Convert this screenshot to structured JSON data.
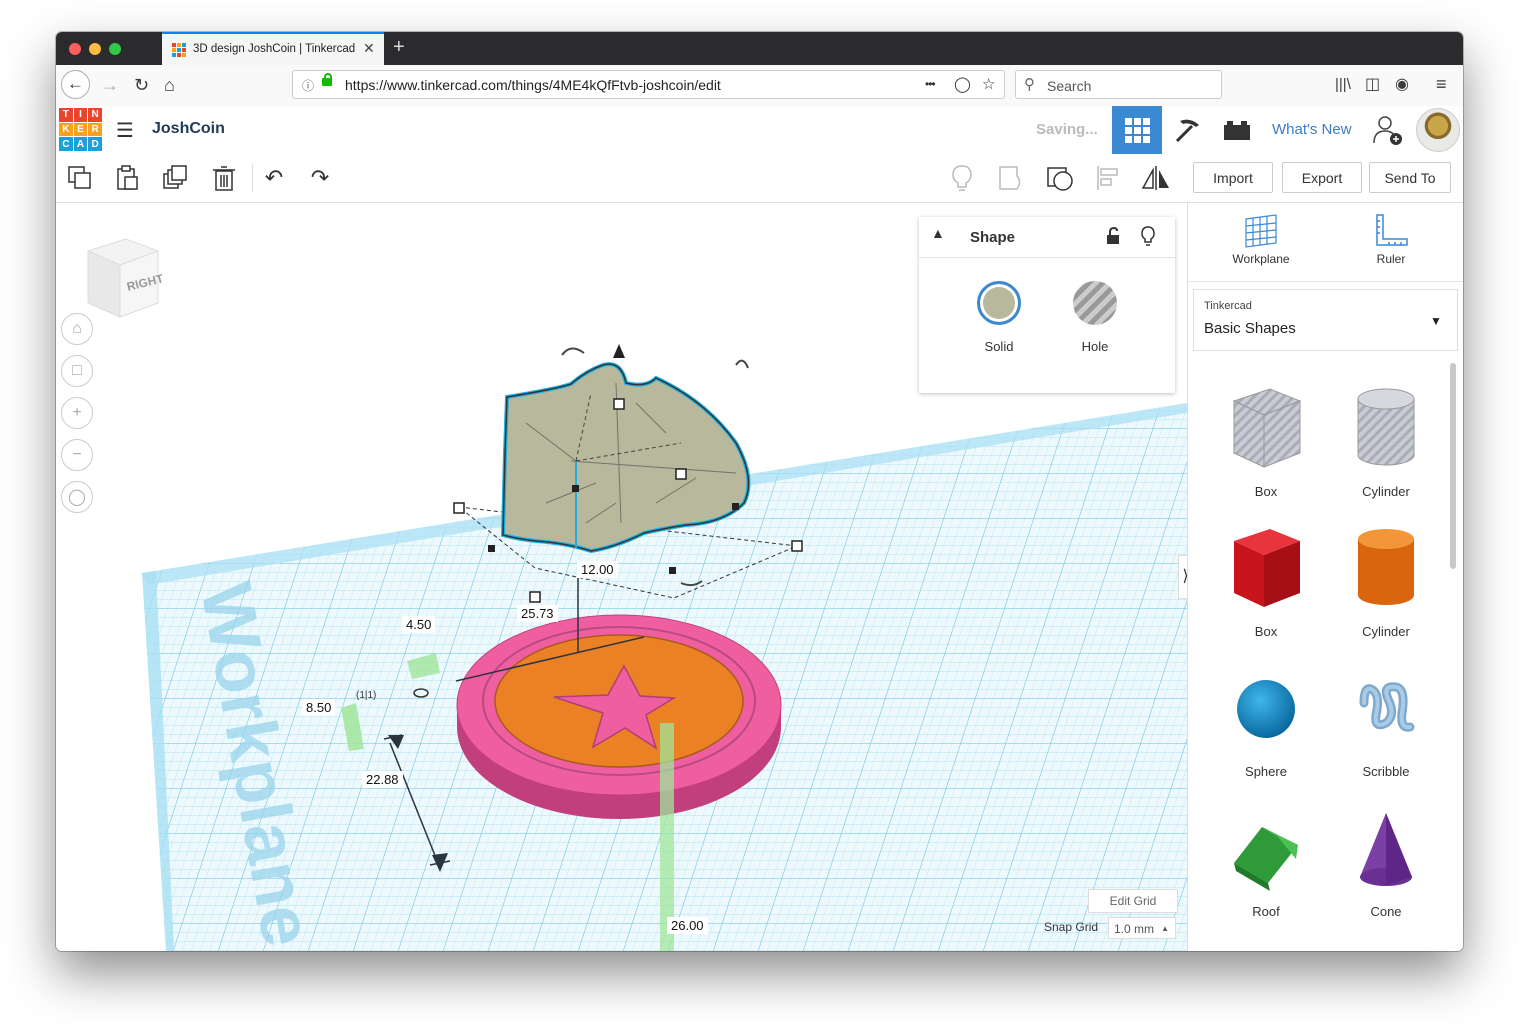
{
  "browser": {
    "tab_title": "3D design JoshCoin | Tinkercad",
    "tab_close": "✕",
    "new_tab": "+",
    "url": "https://www.tinkercad.com/things/4ME4kQfFtvb-joshcoin/edit",
    "search_placeholder": "Search",
    "url_more": "•••"
  },
  "app": {
    "logo_letters": [
      "T",
      "I",
      "N",
      "K",
      "E",
      "R",
      "C",
      "A",
      "D"
    ],
    "design_name": "JoshCoin",
    "status": "Saving...",
    "whats_new": "What's New"
  },
  "toolbar": {
    "import_label": "Import",
    "export_label": "Export",
    "send_to_label": "Send To"
  },
  "viewcube": {
    "face_label": "RIGHT"
  },
  "workplane_text": "Workplane",
  "dimensions": {
    "d1": "12.00",
    "d2": "25.73",
    "d3": "4.50",
    "d4": "8.50",
    "d5": "22.88",
    "d6": "26.00"
  },
  "shape_panel": {
    "title": "Shape",
    "solid_label": "Solid",
    "hole_label": "Hole",
    "solid_color": "#b8b89c"
  },
  "grid": {
    "edit_grid_label": "Edit Grid",
    "snap_label": "Snap Grid",
    "snap_value": "1.0 mm"
  },
  "right_panel": {
    "workplane_label": "Workplane",
    "ruler_label": "Ruler",
    "library_source": "Tinkercad",
    "library_name": "Basic Shapes",
    "shapes": [
      {
        "label": "Box",
        "icon": "box-hole-icon"
      },
      {
        "label": "Cylinder",
        "icon": "cylinder-hole-icon"
      },
      {
        "label": "Box",
        "icon": "box-red-icon"
      },
      {
        "label": "Cylinder",
        "icon": "cylinder-orange-icon"
      },
      {
        "label": "Sphere",
        "icon": "sphere-icon"
      },
      {
        "label": "Scribble",
        "icon": "scribble-icon"
      },
      {
        "label": "Roof",
        "icon": "roof-icon"
      },
      {
        "label": "Cone",
        "icon": "cone-icon"
      }
    ]
  },
  "colors": {
    "accent": "#3b7dc4",
    "coin_rim": "#ef5fa0",
    "coin_face": "#ec8024",
    "star": "#ef5fa0",
    "grid_blue": "#8fd4ee",
    "selection_outline": "#1eaee0"
  }
}
